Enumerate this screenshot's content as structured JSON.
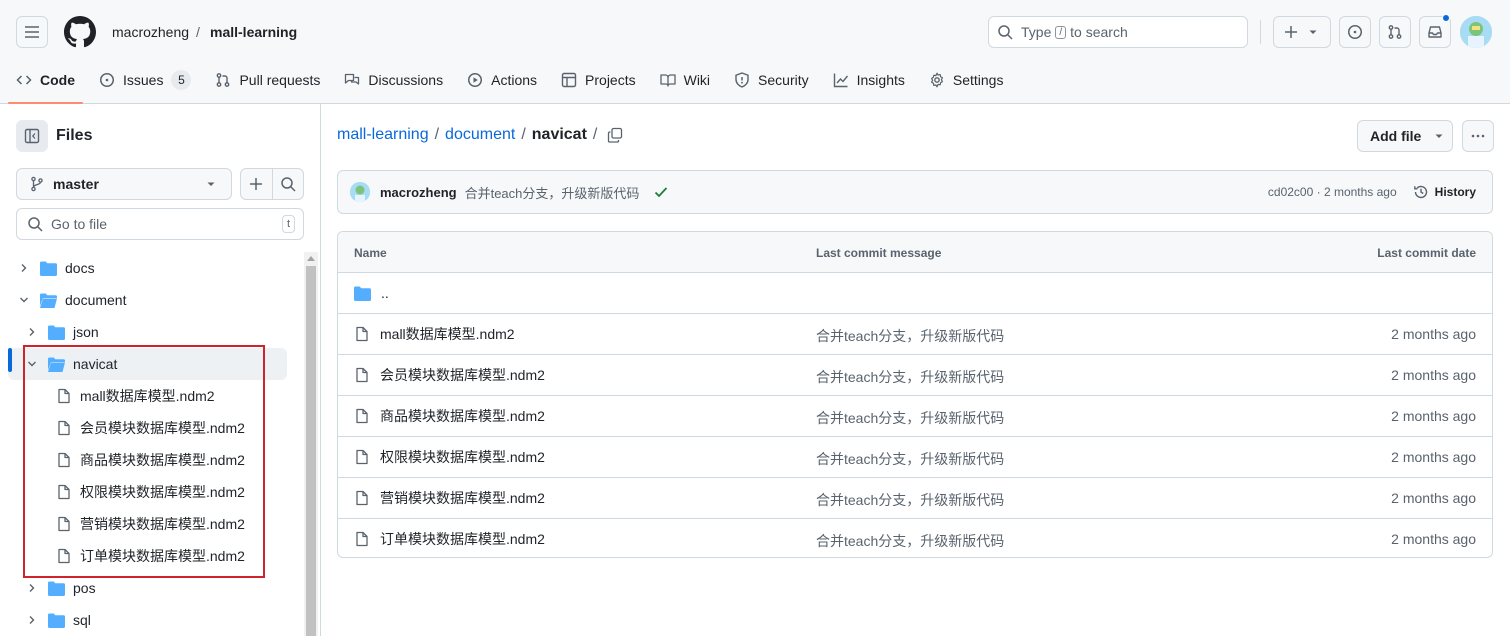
{
  "header": {
    "owner": "macrozheng",
    "separator": "/",
    "repo": "mall-learning",
    "search_prefix": "Type",
    "search_key": "/",
    "search_suffix": "to search"
  },
  "nav": [
    {
      "label": "Code",
      "icon": "code-icon",
      "active": true
    },
    {
      "label": "Issues",
      "icon": "issue-opened-icon",
      "count": "5"
    },
    {
      "label": "Pull requests",
      "icon": "git-pull-request-icon"
    },
    {
      "label": "Discussions",
      "icon": "comment-discussion-icon"
    },
    {
      "label": "Actions",
      "icon": "play-icon"
    },
    {
      "label": "Projects",
      "icon": "table-icon"
    },
    {
      "label": "Wiki",
      "icon": "book-icon"
    },
    {
      "label": "Security",
      "icon": "shield-icon"
    },
    {
      "label": "Insights",
      "icon": "graph-icon"
    },
    {
      "label": "Settings",
      "icon": "gear-icon"
    }
  ],
  "sidebar": {
    "title": "Files",
    "branch": "master",
    "goto_placeholder": "Go to file",
    "goto_key": "t",
    "tree": [
      {
        "label": "docs",
        "type": "folder",
        "expanded": false
      },
      {
        "label": "document",
        "type": "folder",
        "expanded": true
      },
      {
        "label": "json",
        "type": "folder",
        "expanded": false
      },
      {
        "label": "navicat",
        "type": "folder",
        "expanded": true,
        "selected": true
      },
      {
        "label": "mall数据库模型.ndm2",
        "type": "file"
      },
      {
        "label": "会员模块数据库模型.ndm2",
        "type": "file"
      },
      {
        "label": "商品模块数据库模型.ndm2",
        "type": "file"
      },
      {
        "label": "权限模块数据库模型.ndm2",
        "type": "file"
      },
      {
        "label": "营销模块数据库模型.ndm2",
        "type": "file"
      },
      {
        "label": "订单模块数据库模型.ndm2",
        "type": "file"
      },
      {
        "label": "pos",
        "type": "folder",
        "expanded": false
      },
      {
        "label": "sql",
        "type": "folder",
        "expanded": false
      }
    ]
  },
  "main": {
    "breadcrumb": {
      "root": "mall-learning",
      "parent": "document",
      "current": "navicat",
      "sep": "/"
    },
    "add_file": "Add file",
    "commit": {
      "author": "macrozheng",
      "message": "合并teach分支，升级新版代码",
      "meta": "cd02c00 · 2 months ago",
      "history": "History"
    },
    "table": {
      "headers": {
        "name": "Name",
        "message": "Last commit message",
        "date": "Last commit date"
      },
      "parent_dir": "..",
      "rows": [
        {
          "name": "mall数据库模型.ndm2",
          "message": "合并teach分支，升级新版代码",
          "date": "2 months ago"
        },
        {
          "name": "会员模块数据库模型.ndm2",
          "message": "合并teach分支，升级新版代码",
          "date": "2 months ago"
        },
        {
          "name": "商品模块数据库模型.ndm2",
          "message": "合并teach分支，升级新版代码",
          "date": "2 months ago"
        },
        {
          "name": "权限模块数据库模型.ndm2",
          "message": "合并teach分支，升级新版代码",
          "date": "2 months ago"
        },
        {
          "name": "营销模块数据库模型.ndm2",
          "message": "合并teach分支，升级新版代码",
          "date": "2 months ago"
        },
        {
          "name": "订单模块数据库模型.ndm2",
          "message": "合并teach分支，升级新版代码",
          "date": "2 months ago"
        }
      ]
    }
  },
  "colors": {
    "accent_blue": "#0969da",
    "folder_blue": "#54aeff",
    "active_tab_underline": "#fd8c73",
    "success_green": "#1a7f37",
    "highlight_red": "#d0242c"
  }
}
